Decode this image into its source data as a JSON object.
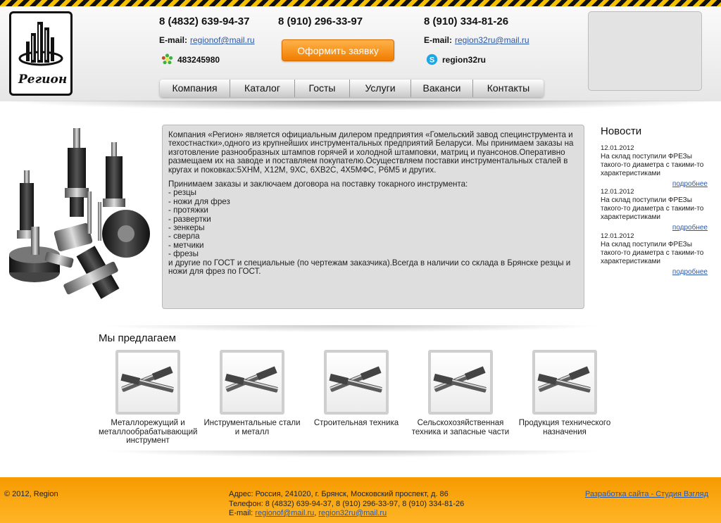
{
  "header": {
    "logo_text": "Регион",
    "phones": [
      "8 (4832) 639-94-37",
      "8 (910) 296-33-97",
      "8 (910) 334-81-26"
    ],
    "email_label": "E-mail:",
    "email_1": "regionof@mail.ru",
    "email_2": "region32ru@mail.ru",
    "icq": "483245980",
    "skype": "region32ru",
    "order_button": "Оформить заявку"
  },
  "nav": {
    "items": [
      "Компания",
      "Каталог",
      "Госты",
      "Услуги",
      "Ваканси",
      "Контакты"
    ]
  },
  "about": {
    "para1": "Компания «Регион» является официальным дилером предприятия «Гомельский завод специнструмента и техостнастки»,одного из крупнейших инструментальных предприятий Беларуси. Мы принимаем заказы на изготовление разнообразных штампов горячей и холодной штамповки, матриц и пуансонов.Оперативно размещаем их на заводе и поставляем покупателю.Осуществляем поставки инструментальных сталей в кругах и поковках:5ХНМ, Х12М, 9ХС, 6ХВ2С, 4Х5МФС, Р6М5 и других.",
    "para2_intro": "Принимаем заказы и заключаем договора на поставку токарного инструмента:",
    "list": [
      "- резцы",
      "- ножи для фрез",
      "- протяжки",
      "- развертки",
      "- зенкеры",
      "- сверла",
      "- метчики",
      "- фрезы"
    ],
    "para2_outro": "и другие по ГОСТ и специальные (по чертежам заказчика).Всегда в наличии со склада в Брянске резцы и ножи для фрез по ГОСТ."
  },
  "news": {
    "title": "Новости",
    "items": [
      {
        "date": "12.01.2012",
        "text": "На склад поступили ФРЕЗы такого-то диаметра с такими-то характеристиками",
        "more": "подробнее"
      },
      {
        "date": "12.01.2012",
        "text": "На склад поступили ФРЕЗы такого-то диаметра с такими-то характеристиками",
        "more": "подробнее"
      },
      {
        "date": "12.01.2012",
        "text": "На склад поступили ФРЕЗы такого-то диаметра с такими-то характеристиками",
        "more": "подробнее"
      }
    ]
  },
  "offers": {
    "title": "Мы предлагаем",
    "items": [
      "Металлорежущий и металлообрабатывающий инструмент",
      "Инструментальные стали и металл",
      "Строительная техника",
      "Сельскохозяйственная техника и запасные части",
      "Продукция технического назначения"
    ]
  },
  "footer": {
    "copyright": "© 2012, Region",
    "address": "Адрес: Россия, 241020, г. Брянск, Московский проспект, д. 86",
    "phones": "Телефон: 8 (4832) 639-94-37, 8 (910) 296-33-97, 8 (910) 334-81-26",
    "email_label": "E-mail:",
    "email_1": "regionof@mail.ru",
    "email_2": "region32ru@mail.ru",
    "dev_link": "Разработка сайта - Студия Взгляд"
  },
  "colors": {
    "accent_orange": "#f07d00",
    "link_blue": "#2a57a8",
    "footer_orange": "#ffb526"
  }
}
